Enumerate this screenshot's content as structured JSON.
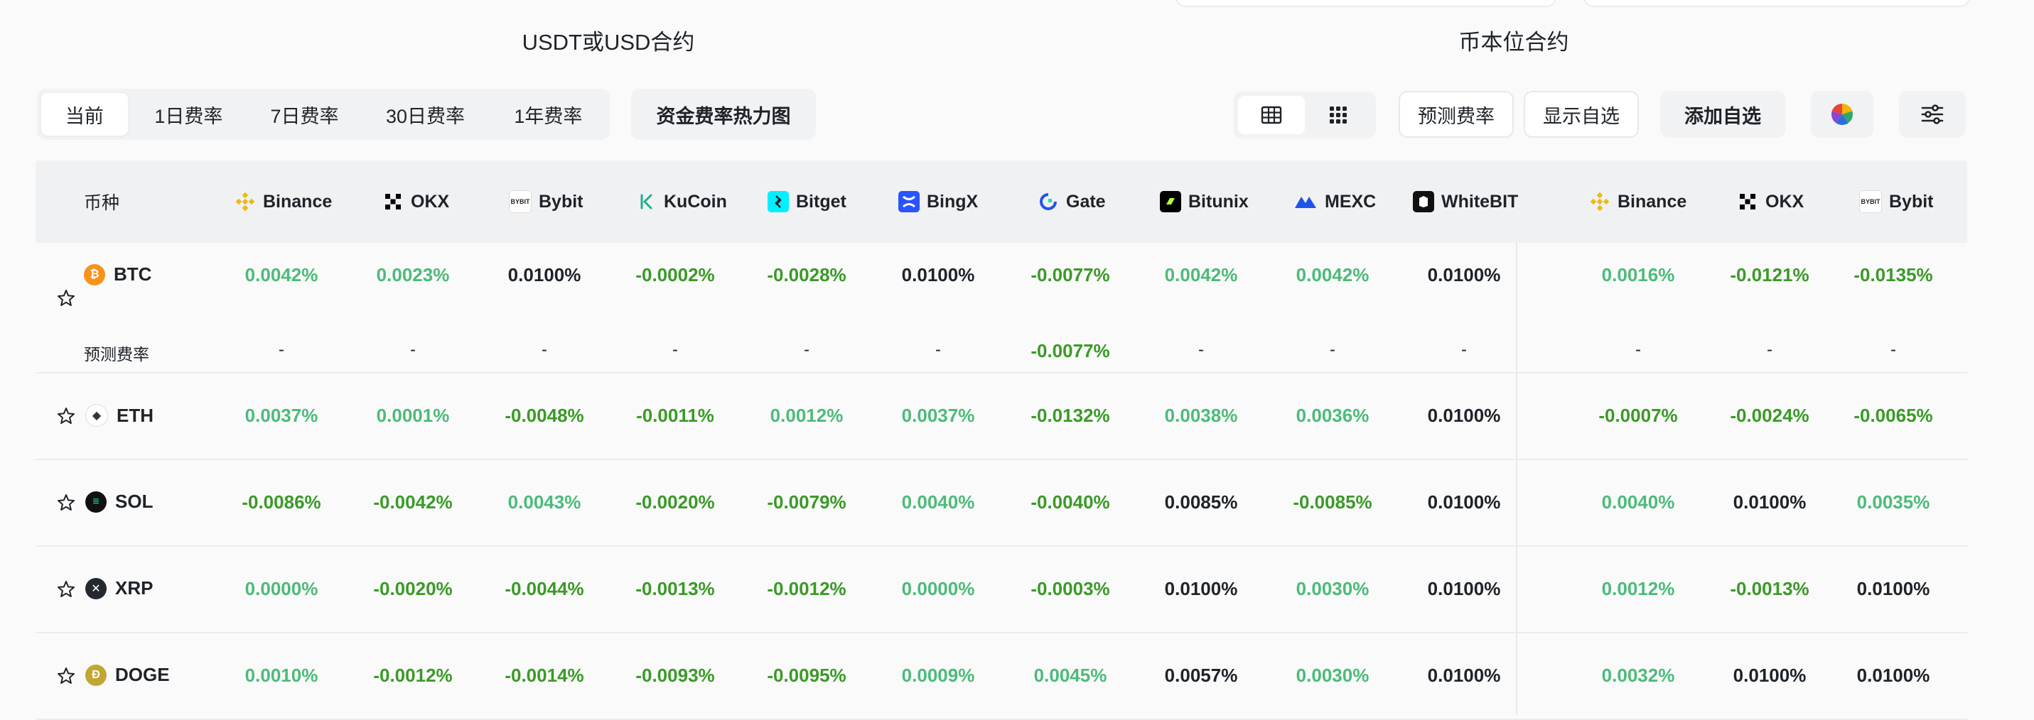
{
  "groups": {
    "usdt": "USDT或USD合约",
    "coin": "币本位合约"
  },
  "tabs": [
    "当前",
    "1日费率",
    "7日费率",
    "30日费率",
    "1年费率"
  ],
  "active_tab": "当前",
  "heatmap_label": "资金费率热力图",
  "view_modes": [
    "table-icon",
    "grid-icon"
  ],
  "buttons": {
    "predict": "预测费率",
    "show_watch": "显示自选",
    "add_watch": "添加自选"
  },
  "table": {
    "symbol_header": "币种",
    "exchanges": [
      "Binance",
      "OKX",
      "Bybit",
      "KuCoin",
      "Bitget",
      "BingX",
      "Gate",
      "Bitunix",
      "MEXC",
      "WhiteBIT",
      "Binance",
      "OKX",
      "Bybit"
    ],
    "predict_label": "预测费率",
    "rows": [
      {
        "symbol": "BTC",
        "values": [
          "0.0042%",
          "0.0023%",
          "0.0100%",
          "-0.0002%",
          "-0.0028%",
          "0.0100%",
          "-0.0077%",
          "0.0042%",
          "0.0042%",
          "0.0100%",
          "0.0016%",
          "-0.0121%",
          "-0.0135%"
        ],
        "predicted": [
          "-",
          "-",
          "-",
          "-",
          "-",
          "-",
          "-0.0077%",
          "-",
          "-",
          "-",
          "-",
          "-",
          "-"
        ]
      },
      {
        "symbol": "ETH",
        "values": [
          "0.0037%",
          "0.0001%",
          "-0.0048%",
          "-0.0011%",
          "0.0012%",
          "0.0037%",
          "-0.0132%",
          "0.0038%",
          "0.0036%",
          "0.0100%",
          "-0.0007%",
          "-0.0024%",
          "-0.0065%"
        ]
      },
      {
        "symbol": "SOL",
        "values": [
          "-0.0086%",
          "-0.0042%",
          "0.0043%",
          "-0.0020%",
          "-0.0079%",
          "0.0040%",
          "-0.0040%",
          "0.0085%",
          "-0.0085%",
          "0.0100%",
          "0.0040%",
          "0.0100%",
          "0.0035%"
        ]
      },
      {
        "symbol": "XRP",
        "values": [
          "0.0000%",
          "-0.0020%",
          "-0.0044%",
          "-0.0013%",
          "-0.0012%",
          "0.0000%",
          "-0.0003%",
          "0.0100%",
          "0.0030%",
          "0.0100%",
          "0.0012%",
          "-0.0013%",
          "0.0100%"
        ]
      },
      {
        "symbol": "DOGE",
        "values": [
          "0.0010%",
          "-0.0012%",
          "-0.0014%",
          "-0.0093%",
          "-0.0095%",
          "0.0009%",
          "0.0045%",
          "0.0057%",
          "0.0030%",
          "0.0100%",
          "0.0032%",
          "0.0100%",
          "0.0100%"
        ]
      }
    ]
  },
  "colors": {
    "positive": "#4cbb7a",
    "negative": "#3a9a27",
    "neutral": "#1e2329"
  }
}
